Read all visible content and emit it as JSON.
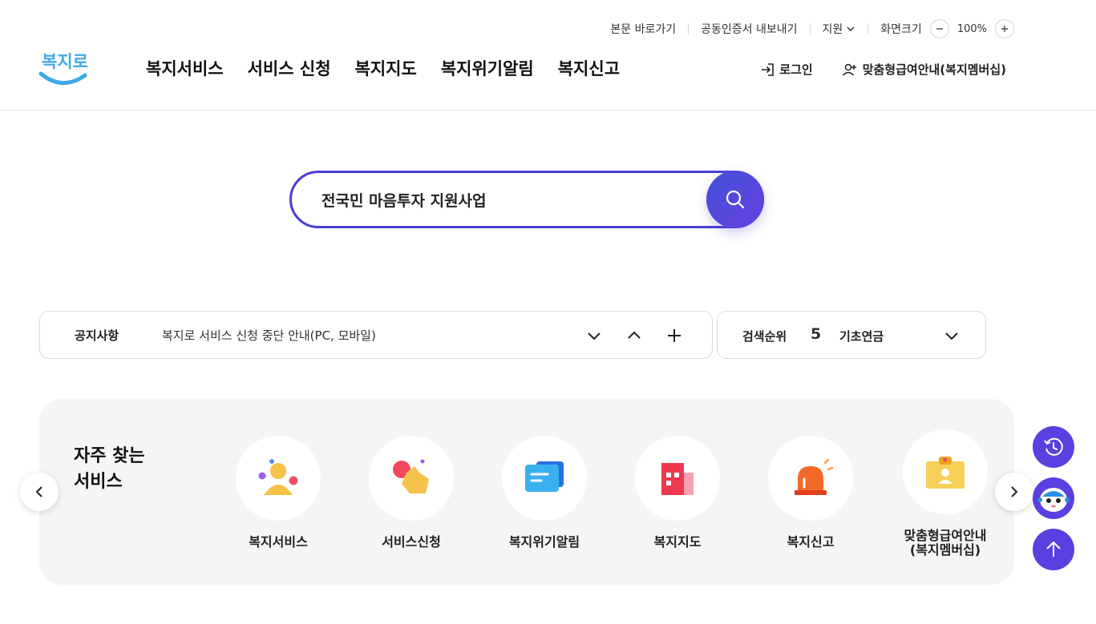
{
  "utility": {
    "skip_to_content": "본문 바로가기",
    "cert_export": "공동인증서 내보내기",
    "support": "지원",
    "zoom_label": "화면크기",
    "zoom_value": "100%"
  },
  "header": {
    "logo_text": "복지로",
    "nav": [
      "복지서비스",
      "서비스 신청",
      "복지지도",
      "복지위기알림",
      "복지신고"
    ],
    "login": "로그인",
    "membership": "맞춤형급여안내(복지멤버십)"
  },
  "search": {
    "value": "전국민 마음투자 지원사업"
  },
  "notice": {
    "label": "공지사항",
    "text": "복지로 서비스 신청 중단 안내(PC, 모바일)"
  },
  "rank": {
    "label": "검색순위",
    "number": "5",
    "term": "기초연금"
  },
  "frequent": {
    "title_line1": "자주 찾는",
    "title_line2": "서비스",
    "items": [
      {
        "label": "복지서비스",
        "icon": "people-icon"
      },
      {
        "label": "서비스신청",
        "icon": "hand-tap-icon"
      },
      {
        "label": "복지위기알림",
        "icon": "message-icon"
      },
      {
        "label": "복지지도",
        "icon": "map-building-icon"
      },
      {
        "label": "복지신고",
        "icon": "siren-icon"
      },
      {
        "label_line1": "맞춤형급여안내",
        "label_line2": "(복지멤버십)",
        "icon": "id-card-icon"
      }
    ]
  },
  "colors": {
    "accent": "#4a3fd6",
    "float_button": "#5b3fe0"
  }
}
